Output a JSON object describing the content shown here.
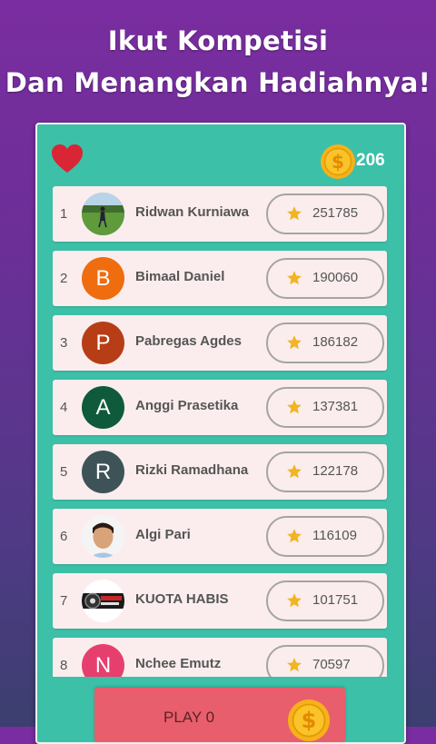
{
  "header": {
    "line1": "Ikut Kompetisi",
    "line2": "Dan Menangkan Hadiahnya!"
  },
  "status": {
    "heart_icon": "heart-icon",
    "coin_icon": "dollar-coin-icon",
    "coins": "206"
  },
  "leaderboard": [
    {
      "rank": "1",
      "name": "Ridwan Kurniawa",
      "score": "251785",
      "avatar_type": "photo",
      "avatar_letter": "",
      "avatar_color": "#4e8a3a"
    },
    {
      "rank": "2",
      "name": "Bimaal Daniel",
      "score": "190060",
      "avatar_type": "letter",
      "avatar_letter": "B",
      "avatar_color": "#ef6c0f"
    },
    {
      "rank": "3",
      "name": "Pabregas Agdes",
      "score": "186182",
      "avatar_type": "letter",
      "avatar_letter": "P",
      "avatar_color": "#b73d17"
    },
    {
      "rank": "4",
      "name": "Anggi Prasetika",
      "score": "137381",
      "avatar_type": "letter",
      "avatar_letter": "A",
      "avatar_color": "#0f5a3b"
    },
    {
      "rank": "5",
      "name": "Rizki Ramadhana",
      "score": "122178",
      "avatar_type": "letter",
      "avatar_letter": "R",
      "avatar_color": "#3e5358"
    },
    {
      "rank": "6",
      "name": "Algi Pari",
      "score": "116109",
      "avatar_type": "photo",
      "avatar_letter": "",
      "avatar_color": "#d9a37a"
    },
    {
      "rank": "7",
      "name": "KUOTA HABIS",
      "score": "101751",
      "avatar_type": "logo",
      "avatar_letter": "",
      "avatar_color": "#1a1a1a"
    },
    {
      "rank": "8",
      "name": "Nchee Emutz",
      "score": "70597",
      "avatar_type": "letter",
      "avatar_letter": "N",
      "avatar_color": "#e63f6e"
    }
  ],
  "play_button": {
    "label": "PLAY 0",
    "icon": "dollar-coin-icon"
  },
  "colors": {
    "panel": "#3cc0a8",
    "row": "#fbedee",
    "play": "#e95e6c",
    "star": "#f2b422",
    "coin": "#f6b21a"
  }
}
